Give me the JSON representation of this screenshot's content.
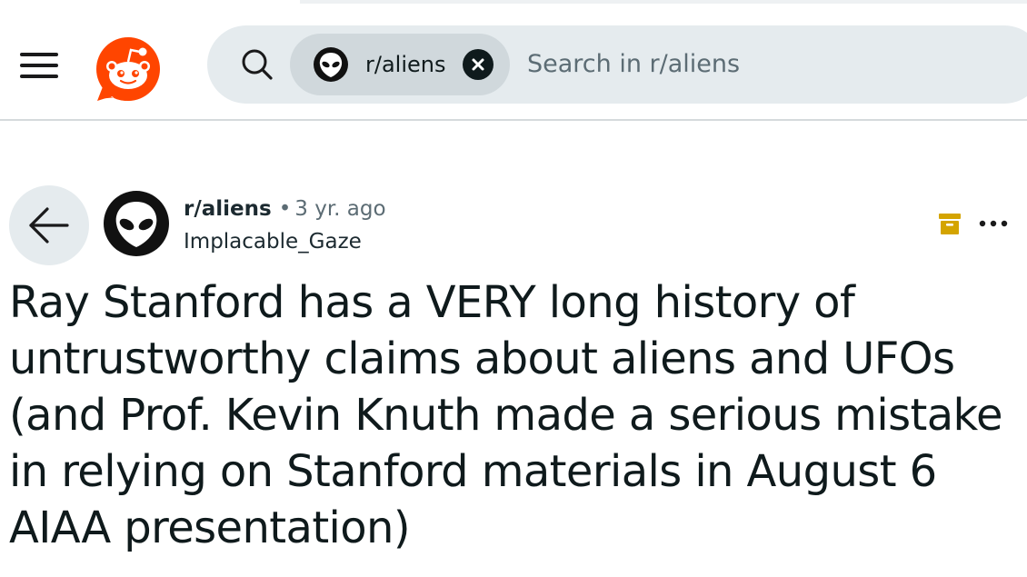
{
  "header": {
    "search": {
      "chip_label": "r/aliens",
      "placeholder": "Search in r/aliens"
    },
    "icons": {
      "menu": "hamburger-menu-icon",
      "logo": "reddit-snoo-logo",
      "search": "search-icon",
      "chip_avatar": "alien-avatar-icon",
      "chip_close": "close-icon"
    }
  },
  "post": {
    "subreddit": "r/aliens",
    "separator": "•",
    "age": "3 yr. ago",
    "author": "Implacable_Gaze",
    "title": "Ray Stanford has a VERY long history of untrustworthy claims about aliens and UFOs (and Prof. Kevin Knuth made a serious mistake in relying on Stanford materials in August 6 AIAA presentation)",
    "icons": {
      "back": "back-arrow-icon",
      "avatar": "alien-avatar-icon",
      "archived": "archive-icon",
      "overflow": "more-options-icon"
    }
  },
  "colors": {
    "brand": "#ff4500",
    "archived": "#d4a400",
    "search_bg": "#e5ebee",
    "chip_bg": "#d0d8dc",
    "text": "#0f1a1c",
    "muted": "#5c6c74"
  }
}
